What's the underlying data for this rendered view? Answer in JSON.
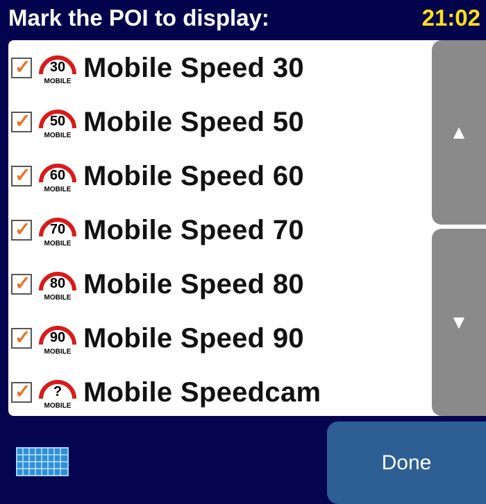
{
  "header": {
    "title": "Mark the POI to display:",
    "time": "21:02"
  },
  "items": [
    {
      "label": "Mobile Speed 30",
      "icon": "mobile-speed-camera-icon",
      "icon_text": "30",
      "sub_text": "MOBILE",
      "checked": true
    },
    {
      "label": "Mobile Speed 50",
      "icon": "mobile-speed-camera-icon",
      "icon_text": "50",
      "sub_text": "MOBILE",
      "checked": true
    },
    {
      "label": "Mobile Speed 60",
      "icon": "mobile-speed-camera-icon",
      "icon_text": "60",
      "sub_text": "MOBILE",
      "checked": true
    },
    {
      "label": "Mobile Speed 70",
      "icon": "mobile-speed-camera-icon",
      "icon_text": "70",
      "sub_text": "MOBILE",
      "checked": true
    },
    {
      "label": "Mobile Speed 80",
      "icon": "mobile-speed-camera-icon",
      "icon_text": "80",
      "sub_text": "MOBILE",
      "checked": true
    },
    {
      "label": "Mobile Speed 90",
      "icon": "mobile-speed-camera-icon",
      "icon_text": "90",
      "sub_text": "MOBILE",
      "checked": true
    },
    {
      "label": "Mobile Speedcam",
      "icon": "mobile-speed-camera-icon",
      "icon_text": "?",
      "sub_text": "MOBILE",
      "checked": true
    }
  ],
  "controls": {
    "scroll_up_icon": "up-arrow-icon",
    "scroll_down_icon": "down-arrow-icon",
    "keyboard_icon": "keyboard-icon",
    "done_label": "Done"
  },
  "colors": {
    "background": "#050550",
    "time": "#ffe11a",
    "checkmark": "#e8722a",
    "sign_ring": "#d81b1b",
    "scroll_button": "#8a8a8a",
    "done_button": "#2d5f95"
  }
}
